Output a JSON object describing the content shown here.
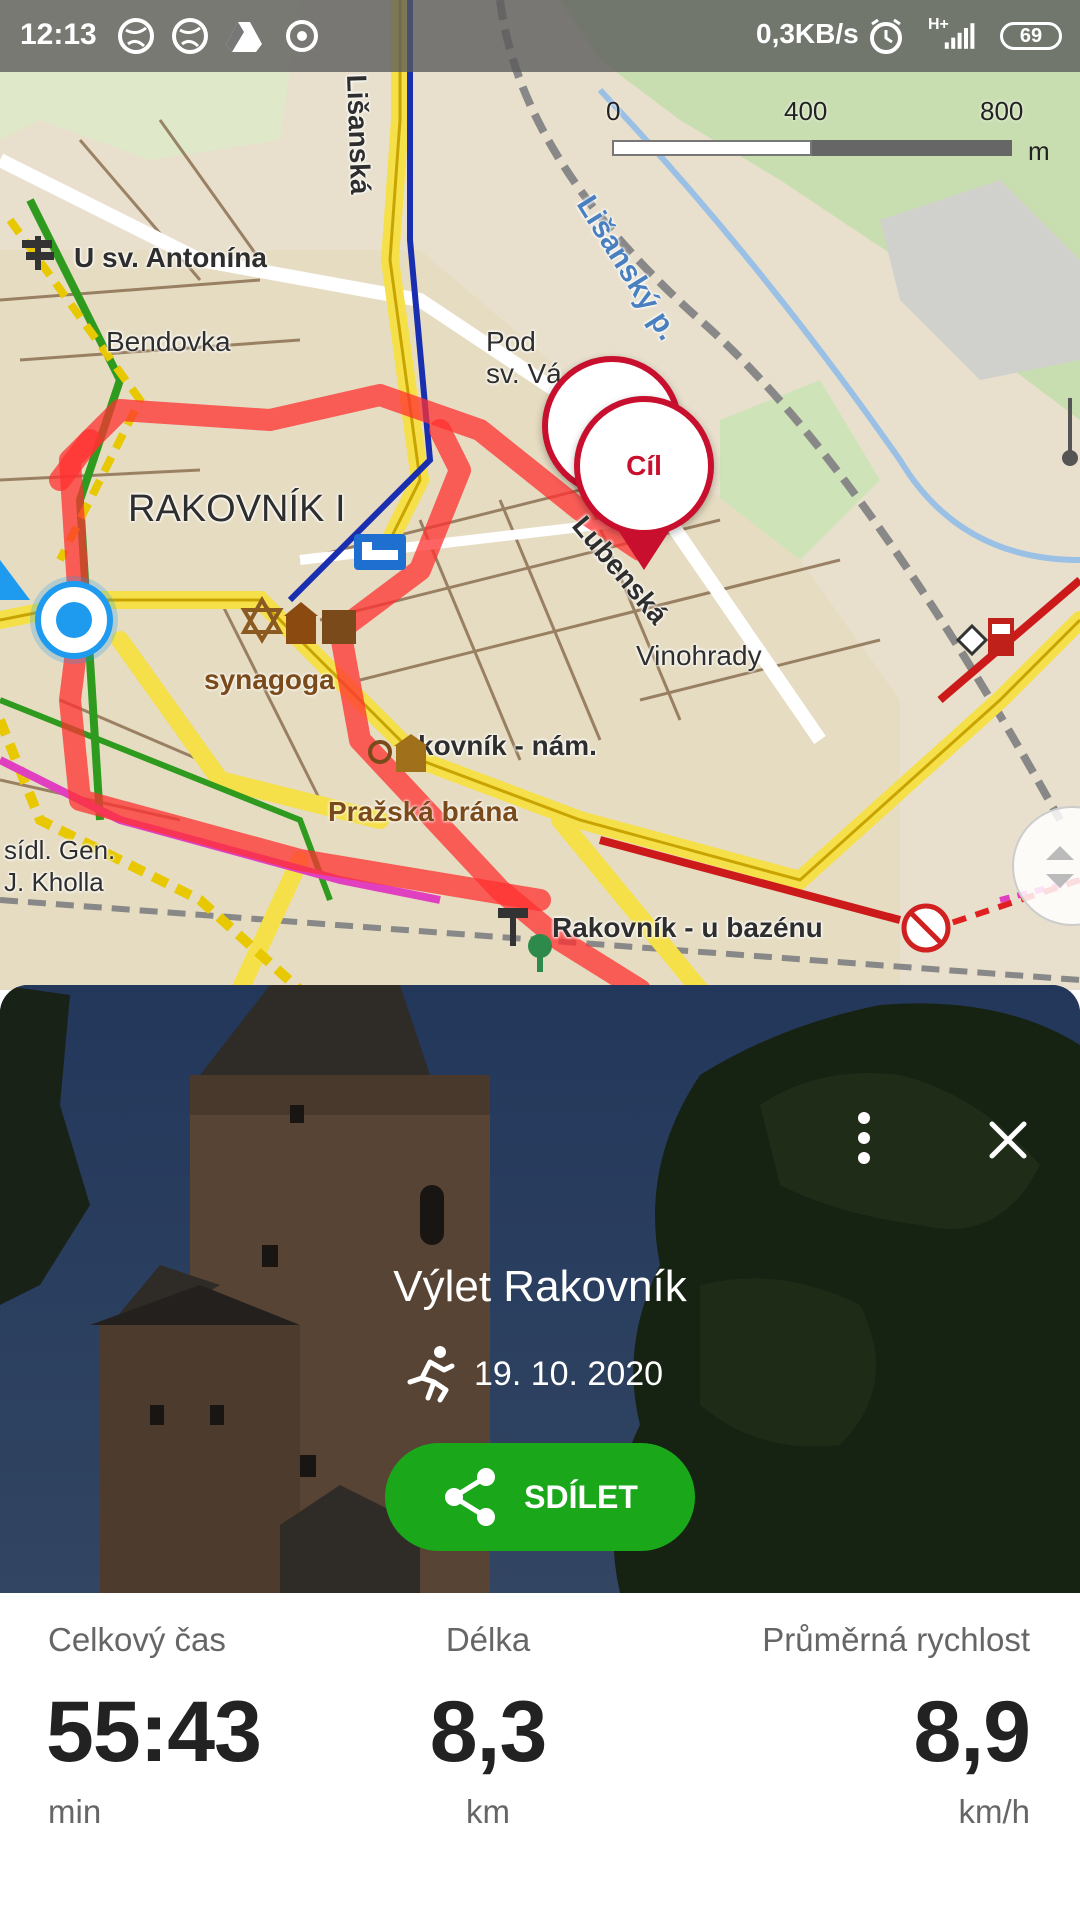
{
  "status_bar": {
    "time": "12:13",
    "network_speed": "0,3KB/s",
    "signal_type": "H+",
    "battery": "69",
    "icons": [
      "globe-icon",
      "globe-icon",
      "drive-icon",
      "sync-icon",
      "alarm-icon",
      "signal-icon",
      "battery-icon"
    ]
  },
  "map": {
    "scale": {
      "ticks": [
        "0",
        "400",
        "800"
      ],
      "unit": "m"
    },
    "labels": {
      "lisanska": "Lišanská",
      "lisansky_potok": "Lišanský p.",
      "u_sv_antonina": "U sv. Antonína",
      "bendovka": "Bendovka",
      "pod_sv": "Pod\nsv. Vá",
      "rakovnik": "RAKOVNÍK I",
      "lubenska": "Lubenská",
      "vinohrady": "Vinohrady",
      "synagoga": "synagoga",
      "namesti": "kovník - nám.",
      "prazska_brana": "Pražská brána",
      "sidl_gen": "sídl. Gen.\nJ. Kholla",
      "u_bazenu": "Rakovník - u bazénu"
    },
    "pins": {
      "finish_label": "Cíl"
    },
    "colors": {
      "route": "#ff3030",
      "pin": "#c8102e",
      "road_yellow": "#f5e04a",
      "current_location": "#1e9bef"
    }
  },
  "trip": {
    "title": "Výlet Rakovník",
    "activity_icon": "running-icon",
    "date": "19. 10. 2020",
    "share_label": "SDÍLET",
    "share_color": "#1aa81a"
  },
  "stats": {
    "total_time": {
      "label": "Celkový čas",
      "value": "55:43",
      "unit": "min"
    },
    "length": {
      "label": "Délka",
      "value": "8,3",
      "unit": "km"
    },
    "avg_speed": {
      "label": "Průměrná rychlost",
      "value": "8,9",
      "unit": "km/h"
    }
  }
}
